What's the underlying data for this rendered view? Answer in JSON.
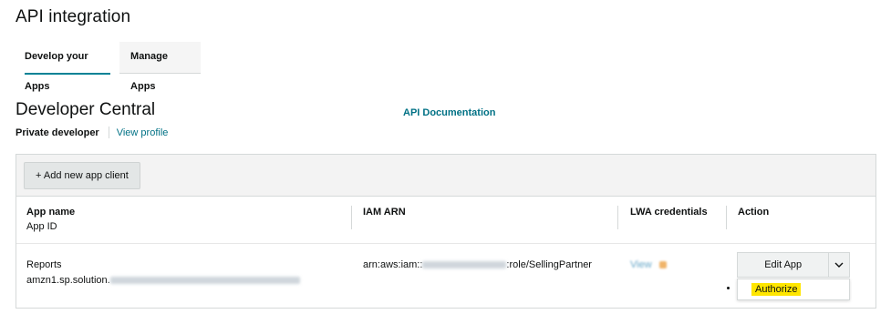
{
  "header": {
    "title": "API integration"
  },
  "tabs": [
    {
      "label": "Develop your Apps",
      "active": true
    },
    {
      "label": "Manage Apps",
      "active": false
    }
  ],
  "developer": {
    "section_title": "Developer Central",
    "type": "Private developer",
    "view_profile": "View profile",
    "api_doc_link": "API Documentation"
  },
  "toolbar": {
    "add_button": "+ Add new app client"
  },
  "table": {
    "headers": {
      "app_name": "App name",
      "app_id": "App ID",
      "iam_arn": "IAM ARN",
      "lwa": "LWA credentials",
      "action": "Action"
    },
    "rows": [
      {
        "app_name": "Reports",
        "app_id_prefix": "amzn1.sp.solution.",
        "arn_prefix": "arn:aws:iam::",
        "arn_suffix": ":role/SellingPartner",
        "lwa_link": "View",
        "edit_button": "Edit App",
        "menu_item": "Authorize"
      }
    ]
  },
  "colors": {
    "accent": "#008296",
    "link": "#007185",
    "highlight": "#ffe600"
  }
}
